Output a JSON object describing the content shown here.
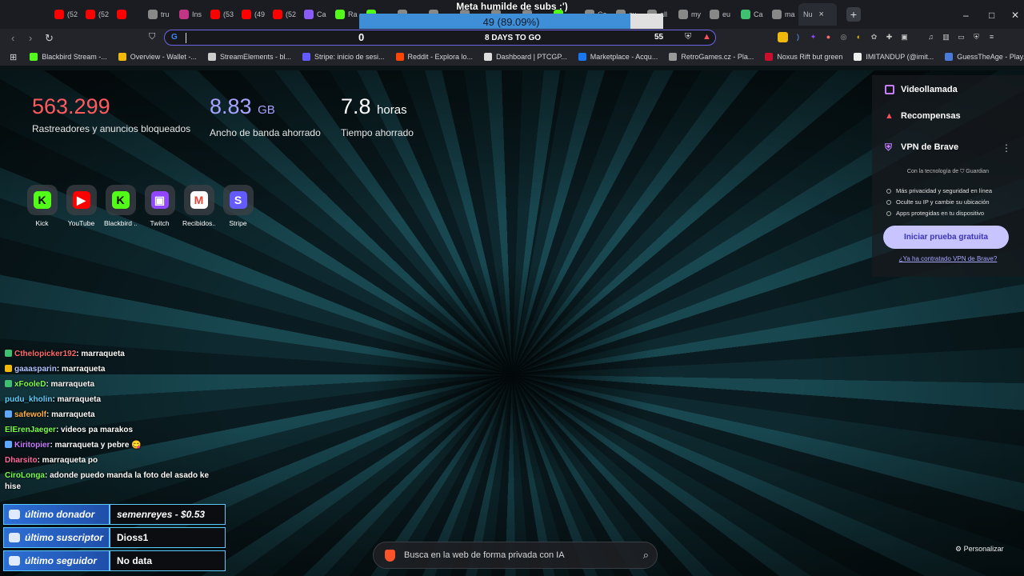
{
  "stream_goal": {
    "title": "Meta humilde de subs :')",
    "progress_text": "49 (89.09%)",
    "progress_fraction": 0.8909
  },
  "tabs": [
    {
      "label": "(52",
      "color": "#ff0000"
    },
    {
      "label": "(52",
      "color": "#ff0000"
    },
    {
      "label": "",
      "color": "#ff0000"
    },
    {
      "label": "tru",
      "color": "#888888"
    },
    {
      "label": "Ins",
      "color": "#c13584"
    },
    {
      "label": "(53",
      "color": "#ff0000"
    },
    {
      "label": "(49",
      "color": "#ff0000"
    },
    {
      "label": "(52",
      "color": "#ff0000"
    },
    {
      "label": "Ca",
      "color": "#8a5cf6"
    },
    {
      "label": "Ra",
      "color": "#53fc18"
    },
    {
      "label": "",
      "color": "#53fc18"
    },
    {
      "label": "",
      "color": "#888888"
    },
    {
      "label": "",
      "color": "#888888"
    },
    {
      "label": "",
      "color": "#888888"
    },
    {
      "label": "",
      "color": "#888888"
    },
    {
      "label": "",
      "color": "#888888"
    },
    {
      "label": "",
      "color": "#53fc18"
    },
    {
      "label": "Ca",
      "color": "#888888"
    },
    {
      "label": "cu",
      "color": "#888888"
    },
    {
      "label": "all",
      "color": "#888888"
    },
    {
      "label": "my",
      "color": "#888888"
    },
    {
      "label": "eu",
      "color": "#888888"
    },
    {
      "label": "Ca",
      "color": "#3fbf6f"
    },
    {
      "label": "ma",
      "color": "#888888"
    }
  ],
  "active_tab": {
    "label": "Nu",
    "close": "×"
  },
  "new_tab": "+",
  "window_controls": {
    "minimize": "–",
    "maximize": "□",
    "close": "✕"
  },
  "address_bar": {
    "counter_left": "0",
    "countdown": "8 DAYS TO GO",
    "counter_right": "55"
  },
  "bookmarks": [
    {
      "label": "Blackbird Stream -...",
      "color": "#53fc18"
    },
    {
      "label": "Overview - Wallet -...",
      "color": "#f0b90b"
    },
    {
      "label": "StreamElements - bl...",
      "color": "#cccccc"
    },
    {
      "label": "Stripe: inicio de sesi...",
      "color": "#635bff"
    },
    {
      "label": "Reddit - Explora lo...",
      "color": "#ff4500"
    },
    {
      "label": "Dashboard | PTCGP...",
      "color": "#dddddd"
    },
    {
      "label": "Marketplace - Acqu...",
      "color": "#1877f2"
    },
    {
      "label": "RetroGames.cz - Pla...",
      "color": "#999999"
    },
    {
      "label": "Noxus Rift but green",
      "color": "#c8102e"
    },
    {
      "label": "IMITANDUP (@imit...",
      "color": "#eeeeee"
    },
    {
      "label": "GuessTheAge - Play...",
      "color": "#4a7bd8"
    }
  ],
  "stats": {
    "trackers": {
      "value": "563.299",
      "label": "Rastreadores y anuncios bloqueados",
      "color": "#ff5a5f"
    },
    "bandwidth": {
      "value": "8.83",
      "unit": "GB",
      "label": "Ancho de banda ahorrado",
      "color": "#a7a3ff"
    },
    "time": {
      "value": "7.8",
      "unit": "horas",
      "label": "Tiempo ahorrado",
      "color": "#ffffff"
    }
  },
  "shortcuts": [
    {
      "label": "Kick",
      "glyph": "K",
      "bg": "#53fc18",
      "fg": "#000000",
      "icon": "kick-icon"
    },
    {
      "label": "YouTube",
      "glyph": "▶",
      "bg": "#ff0000",
      "fg": "#ffffff",
      "icon": "youtube-icon"
    },
    {
      "label": "Blackbird ...",
      "glyph": "K",
      "bg": "#53fc18",
      "fg": "#000000",
      "icon": "blackbird-icon"
    },
    {
      "label": "Twitch",
      "glyph": "▣",
      "bg": "#9146ff",
      "fg": "#ffffff",
      "icon": "twitch-icon"
    },
    {
      "label": "Recibidos...",
      "glyph": "M",
      "bg": "#ffffff",
      "fg": "#ea4335",
      "icon": "gmail-icon"
    },
    {
      "label": "Stripe",
      "glyph": "S",
      "bg": "#635bff",
      "fg": "#ffffff",
      "icon": "stripe-icon"
    }
  ],
  "panel": {
    "videollamada": "Videollamada",
    "recompensas": "Recompensas",
    "vpn_title": "VPN de Brave",
    "vpn_powered": "Con la tecnología de ⛉ Guardian",
    "vpn_features": [
      "Más privacidad y seguridad en línea",
      "Oculte su IP y cambie su ubicación",
      "Apps protegidas en tu dispositivo"
    ],
    "vpn_cta": "Iniciar prueba gratuita",
    "vpn_link": "¿Ya ha contratado VPN de Brave?",
    "menu": "⋮"
  },
  "chat": [
    {
      "user": "Cthelopicker192",
      "text": ": marraqueta",
      "color": "#ff6b6b",
      "badge": "#3fbf6f"
    },
    {
      "user": "gaaasparin",
      "text": ": marraqueta",
      "color": "#b0c4ff",
      "badge": "#f0b90b"
    },
    {
      "user": "xFooleD",
      "text": ": marraqueta",
      "color": "#7cff4f",
      "badge": "#3fbf6f"
    },
    {
      "user": "pudu_kholin",
      "text": ": marraqueta",
      "color": "#5fd3ff",
      "badge": ""
    },
    {
      "user": "safewolf",
      "text": ": marraqueta",
      "color": "#ffb347",
      "badge": "#5fa8ff"
    },
    {
      "user": "ElErenJaeger",
      "text": ": videos pa marakos",
      "color": "#7cff4f",
      "badge": ""
    },
    {
      "user": "Kiritopier",
      "text": ": marraqueta y pebre 😋",
      "color": "#c77dff",
      "badge": "#5fa8ff"
    },
    {
      "user": "Dharsito",
      "text": ": marraqueta po",
      "color": "#ff6b9d",
      "badge": ""
    },
    {
      "user": "CiroLonga",
      "text": ": adonde puedo manda la foto del asado ke hise",
      "color": "#7cff4f",
      "badge": ""
    }
  ],
  "alerts": [
    {
      "label": "último donador",
      "value": "semenreyes - $0.53",
      "italic": true
    },
    {
      "label": "último suscriptor",
      "value": "Dioss1",
      "italic": false
    },
    {
      "label": "último seguidor",
      "value": "No data",
      "italic": false
    }
  ],
  "ai_search": {
    "placeholder": "Busca en la web de forma privada con IA"
  },
  "customize": "Personalizar"
}
